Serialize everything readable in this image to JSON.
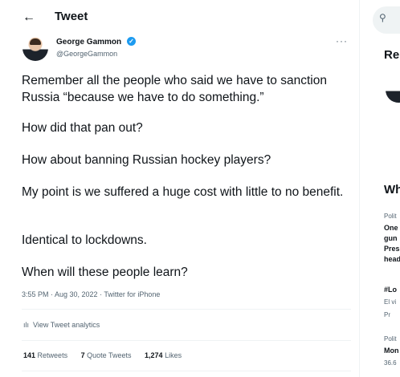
{
  "header": {
    "back_icon": "arrow-left-icon",
    "title": "Tweet"
  },
  "author": {
    "name": "George Gammon",
    "handle": "@GeorgeGammon",
    "verified_icon": "verified-badge-icon",
    "more_icon": "more-options-icon"
  },
  "tweet": {
    "paragraphs": [
      "Remember all the people who said we have to sanction Russia “because we have to do something.”",
      "How did that pan out?",
      "How about banning Russian hockey players?",
      "My point is we suffered a huge cost with little to no benefit.",
      "Identical to lockdowns.",
      "When will these people learn?"
    ],
    "timestamp": "3:55 PM · Aug 30, 2022 · Twitter for iPhone",
    "analytics_label": "View Tweet analytics",
    "stats": {
      "retweets_count": "141",
      "retweets_label": "Retweets",
      "quotes_count": "7",
      "quotes_label": "Quote Tweets",
      "likes_count": "1,274",
      "likes_label": "Likes"
    }
  },
  "sidebar": {
    "search_icon": "search-icon",
    "relevant_title": "Rel",
    "happening_title": "Wh",
    "trends": [
      {
        "category": "Polit",
        "lines": [
          "One",
          "gun",
          "Pres",
          "head"
        ]
      },
      {
        "category": "",
        "lines": [
          "#Lo",
          "El vi",
          "Pr"
        ]
      },
      {
        "category": "Polit",
        "lines": [
          "Mon",
          "36.6"
        ]
      }
    ]
  }
}
